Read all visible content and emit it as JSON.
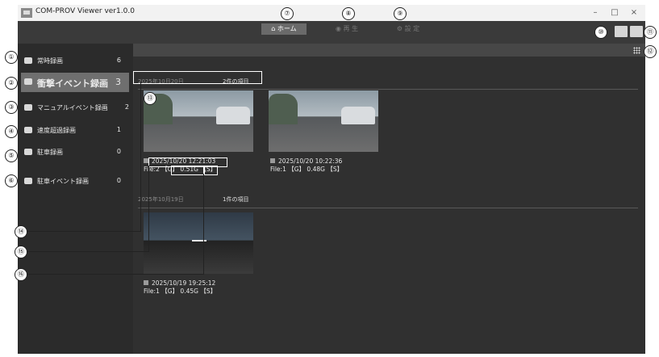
{
  "window": {
    "title": "COM-PROV Viewer ver1.0.0",
    "min": "–",
    "max": "□",
    "close": "×"
  },
  "tabs": [
    {
      "label": "⌂ ホーム",
      "active": true
    },
    {
      "label": "◉ 再 生",
      "active": false
    },
    {
      "label": "⚙ 設 定",
      "active": false
    }
  ],
  "sidebar": {
    "items": [
      {
        "label": "常時録画",
        "count": "6"
      },
      {
        "label": "衝撃イベント録画",
        "count": "3"
      },
      {
        "label": "マニュアルイベント録画",
        "count": "2"
      },
      {
        "label": "速度超過録画",
        "count": "1"
      },
      {
        "label": "駐車録画",
        "count": "0"
      },
      {
        "label": "駐車イベント録画",
        "count": "0"
      }
    ]
  },
  "groups": [
    {
      "date": "2025年10月20日",
      "count": "2件の項目",
      "items": [
        {
          "datetime": "2025/10/20 12:21:03",
          "file": "File:2 【G】 0.51G 【S】"
        },
        {
          "datetime": "2025/10/20 10:22:36",
          "file": "File:1 【G】 0.48G 【S】"
        }
      ]
    },
    {
      "date": "2025年10月19日",
      "count": "1件の項目",
      "items": [
        {
          "datetime": "2025/10/19 19:25:12",
          "file": "File:1 【G】 0.45G 【S】"
        }
      ]
    }
  ],
  "callouts": [
    "①",
    "②",
    "③",
    "④",
    "⑤",
    "⑥",
    "⑦",
    "⑧",
    "⑨",
    "⑩",
    "⑪",
    "⑫",
    "⑬",
    "⑭",
    "⑮",
    "⑯"
  ]
}
